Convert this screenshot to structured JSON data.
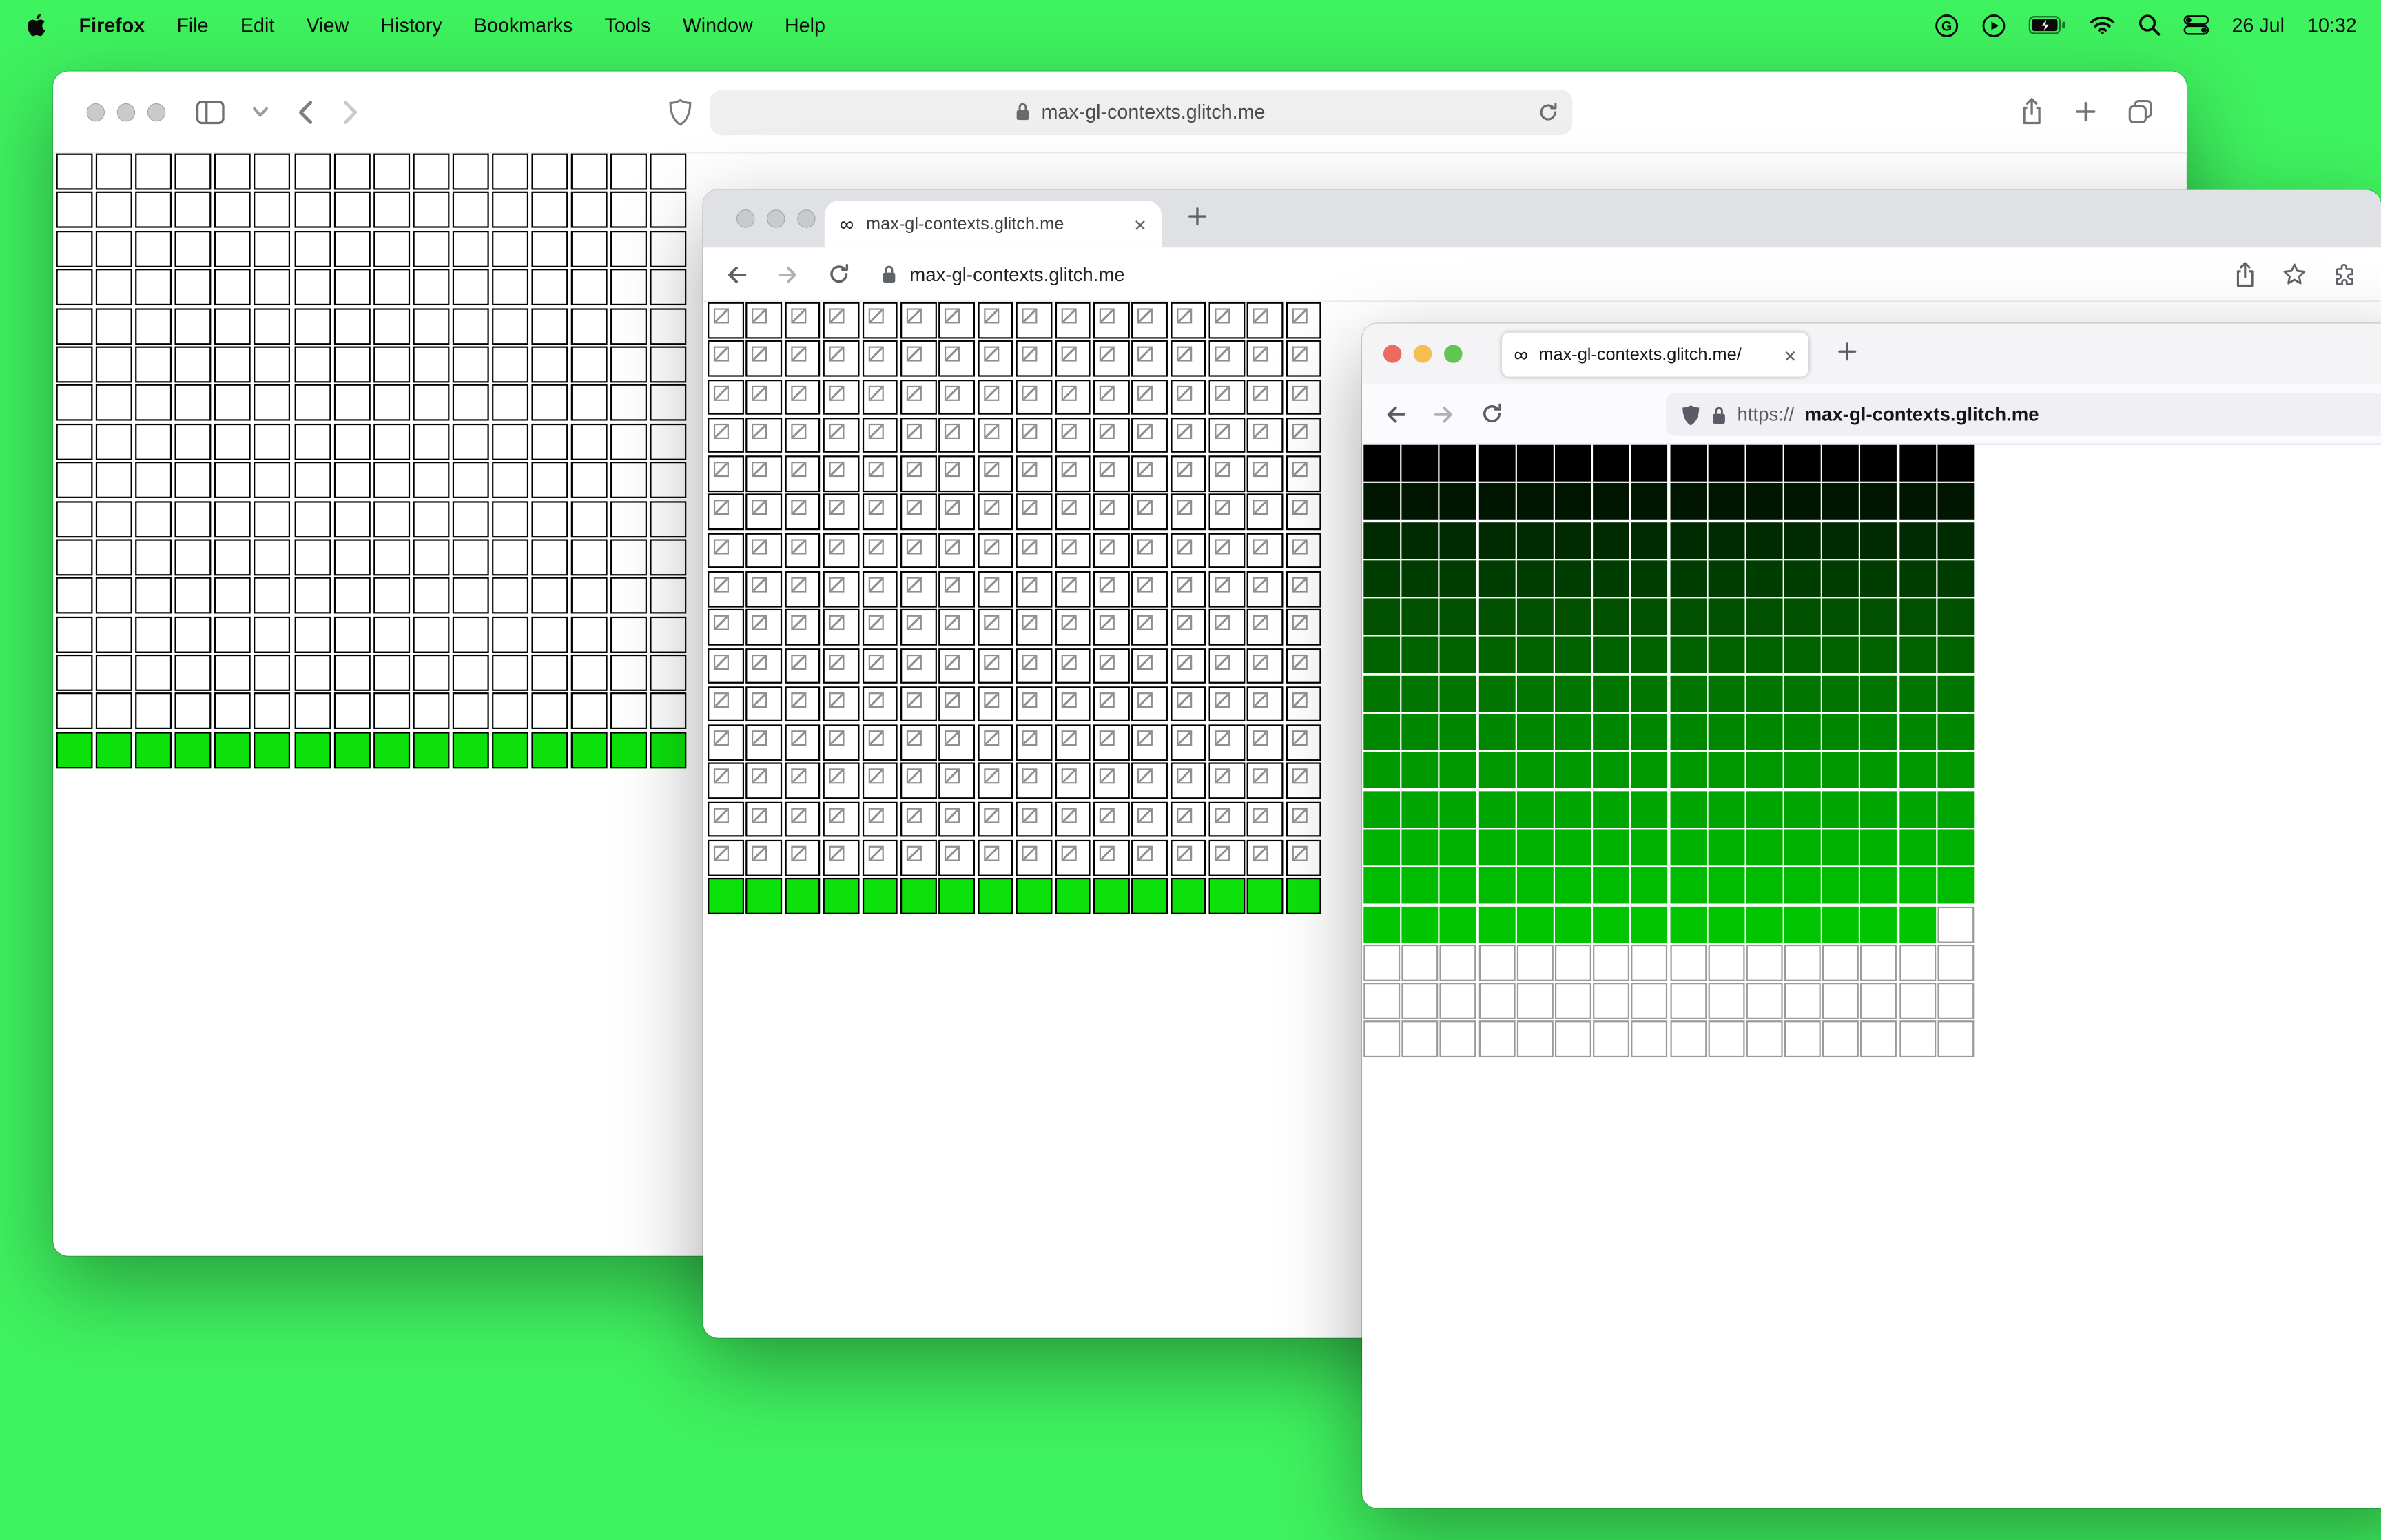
{
  "colors": {
    "desktop_green": "#3ff25f",
    "grid_green": "#0ce10c",
    "chrome_tabstrip": "#dfe1e5",
    "firefox_urlbar_bg": "#f0f0f4",
    "safari_urlfield_bg": "#efeff0"
  },
  "glyphs": {
    "infinity": "∞",
    "close": "×"
  },
  "menubar": {
    "app_name": "Firefox",
    "menus": [
      "File",
      "Edit",
      "View",
      "History",
      "Bookmarks",
      "Tools",
      "Window",
      "Help"
    ],
    "status_icons": [
      "google-g-icon",
      "play-circle-icon",
      "battery-charging-icon",
      "wifi-icon",
      "spotlight-search-icon",
      "control-center-icon"
    ],
    "date": "26 Jul",
    "time": "10:32"
  },
  "safari_window": {
    "url": "max-gl-contexts.glitch.me",
    "toolbar_icons": [
      "sidebar-icon",
      "chevron-down-icon",
      "back-icon",
      "forward-icon",
      "privacy-shield-icon",
      "lock-icon",
      "reload-icon",
      "share-icon",
      "new-tab-icon",
      "tabs-overview-icon"
    ],
    "grid": {
      "cols": 16,
      "cell": 24,
      "gapx": 2.1,
      "gapy": 1.4,
      "border": "#000000",
      "palette": {
        "green": "#0ce10c"
      },
      "rows": [
        {
          "fill": "white",
          "count": 15
        },
        {
          "fill": "green",
          "count": 1
        }
      ]
    }
  },
  "chrome_window": {
    "tab_title": "max-gl-contexts.glitch.me",
    "url": "max-gl-contexts.glitch.me",
    "toolbar_icons": [
      "back-icon",
      "forward-icon",
      "reload-icon",
      "lock-icon",
      "share-icon",
      "bookmark-star-icon",
      "extensions-icon"
    ],
    "grid": {
      "cols": 16,
      "cell": 23.6,
      "gapx": 1.8,
      "gapy": 1.7,
      "border": "#000000",
      "palette": {
        "green": "#0ce10c"
      },
      "rows": [
        {
          "fill": "broken",
          "count": 15
        },
        {
          "fill": "green",
          "count": 1
        }
      ]
    }
  },
  "firefox_window": {
    "tab_title": "max-gl-contexts.glitch.me/",
    "url_prefix": "https://",
    "url_host": "max-gl-contexts.glitch.me",
    "toolbar_icons": [
      "back-icon",
      "forward-icon",
      "reload-icon",
      "tracking-shield-icon",
      "lock-icon"
    ],
    "grid": {
      "cols": 16,
      "cell": 24,
      "gapx": 1.2,
      "gapy": 1.3,
      "whiteBorder": "#9a9a9a",
      "rows": [
        {
          "fill": "#000000"
        },
        {
          "fill": "#001600"
        },
        {
          "fill": "#002a00"
        },
        {
          "fill": "#003d00"
        },
        {
          "fill": "#005000"
        },
        {
          "fill": "#006300"
        },
        {
          "fill": "#007500"
        },
        {
          "fill": "#008700"
        },
        {
          "fill": "#009800"
        },
        {
          "fill": "#00a600"
        },
        {
          "fill": "#00b200"
        },
        {
          "fill": "#00bc00"
        },
        {
          "fill": "#00c500",
          "white_tail": 1
        },
        {
          "fill": "white",
          "count": 3
        }
      ]
    }
  }
}
